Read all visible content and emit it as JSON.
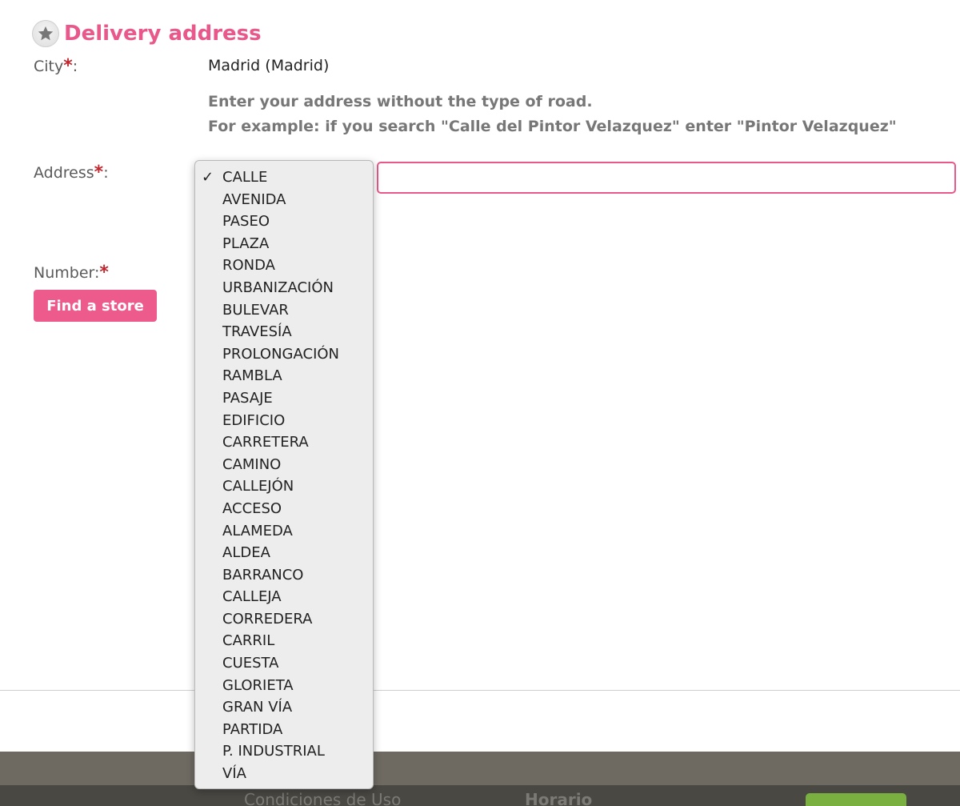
{
  "delivery": {
    "title": "Delivery address",
    "city_label": "City",
    "city_value": "Madrid (Madrid)",
    "hint_line1": "Enter your address without the type of road.",
    "hint_line2": "For example: if you search \"Calle del Pintor Velazquez\" enter \"Pintor Velazquez\"",
    "address_label": "Address",
    "address_value": "",
    "number_label": "Number:",
    "required_mark": "*",
    "colon": ":",
    "find_button": "Find a store"
  },
  "road_type_dropdown": {
    "selected": "CALLE",
    "options": [
      "CALLE",
      "AVENIDA",
      "PASEO",
      "PLAZA",
      "RONDA",
      "URBANIZACIÓN",
      "BULEVAR",
      "TRAVESÍA",
      "PROLONGACIÓN",
      "RAMBLA",
      "PASAJE",
      "EDIFICIO",
      "CARRETERA",
      "CAMINO",
      "CALLEJÓN",
      "ACCESO",
      "ALAMEDA",
      "ALDEA",
      "BARRANCO",
      "CALLEJA",
      "CORREDERA",
      "CARRIL",
      "CUESTA",
      "GLORIETA",
      "GRAN VÍA",
      "PARTIDA",
      "P. INDUSTRIAL",
      "VÍA"
    ]
  },
  "footer": {
    "link_conditions": "Condiciones de Uso",
    "link_schedule": "Horario"
  },
  "colors": {
    "accent_pink": "#e8588a",
    "required_red": "#c0262d",
    "footer_green": "#7ab040"
  },
  "icons": {
    "section_icon": "star-icon",
    "selected_option_icon": "checkmark-icon"
  }
}
